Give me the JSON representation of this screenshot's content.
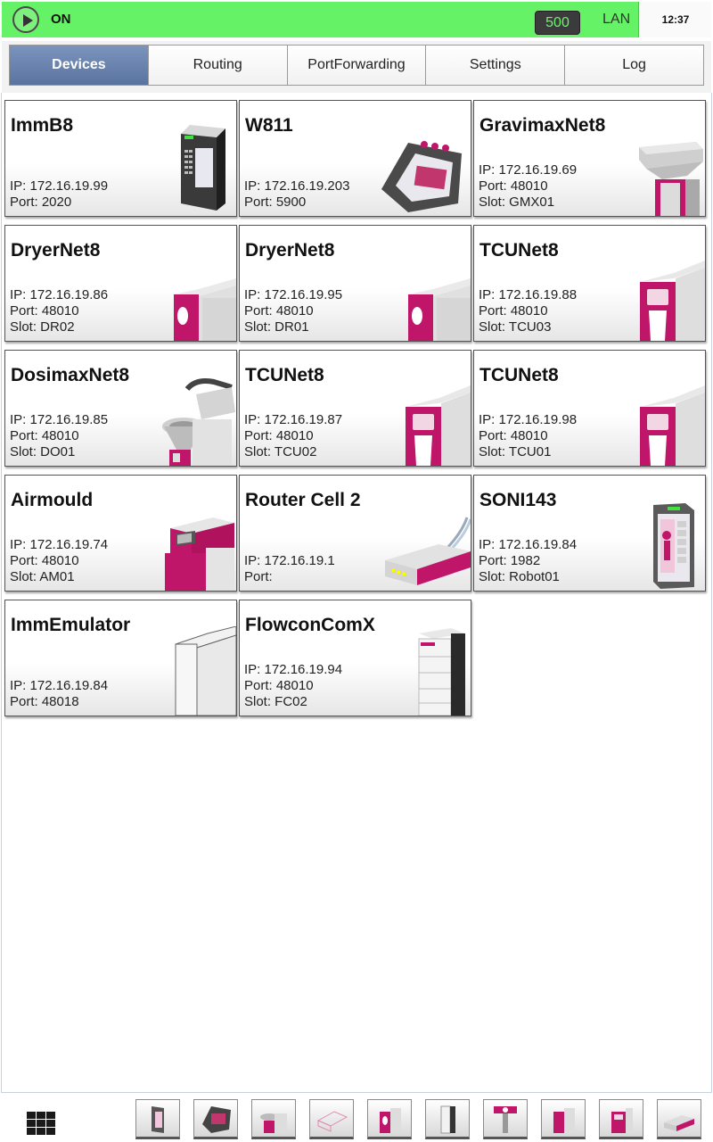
{
  "status": {
    "run_state": "ON",
    "count": "500",
    "connection": "LAN",
    "time": "12:37",
    "colors": {
      "ok_green": "#66f266",
      "badge_bg": "#3b3b3b",
      "tab_active": "#5a74a0",
      "brand_magenta": "#c0166a"
    }
  },
  "tabs": [
    {
      "label": "Devices",
      "active": true
    },
    {
      "label": "Routing",
      "active": false
    },
    {
      "label": "PortForwarding",
      "active": false
    },
    {
      "label": "Settings",
      "active": false
    },
    {
      "label": "Log",
      "active": false
    }
  ],
  "devices": [
    {
      "name": "ImmB8",
      "lines": [
        "IP: 172.16.19.99",
        "Port: 2020"
      ],
      "icon": "imm-controller-icon"
    },
    {
      "name": "W811",
      "lines": [
        "IP: 172.16.19.203",
        "Port: 5900"
      ],
      "icon": "handheld-terminal-icon"
    },
    {
      "name": "GravimaxNet8",
      "lines": [
        "IP: 172.16.19.69",
        "Port: 48010",
        "Slot: GMX01"
      ],
      "icon": "gravimetric-blender-icon"
    },
    {
      "name": "DryerNet8",
      "lines": [
        "IP: 172.16.19.86",
        "Port: 48010",
        "Slot: DR02"
      ],
      "icon": "dryer-icon"
    },
    {
      "name": "DryerNet8",
      "lines": [
        "IP: 172.16.19.95",
        "Port: 48010",
        "Slot: DR01"
      ],
      "icon": "dryer-icon"
    },
    {
      "name": "TCUNet8",
      "lines": [
        "IP: 172.16.19.88",
        "Port: 48010",
        "Slot: TCU03"
      ],
      "icon": "tcu-icon"
    },
    {
      "name": "DosimaxNet8",
      "lines": [
        "IP: 172.16.19.85",
        "Port: 48010",
        "Slot: DO01"
      ],
      "icon": "dosing-unit-icon"
    },
    {
      "name": "TCUNet8",
      "lines": [
        "IP: 172.16.19.87",
        "Port: 48010",
        "Slot: TCU02"
      ],
      "icon": "tcu-icon"
    },
    {
      "name": "TCUNet8",
      "lines": [
        "IP: 172.16.19.98",
        "Port: 48010",
        "Slot: TCU01"
      ],
      "icon": "tcu-icon"
    },
    {
      "name": "Airmould",
      "lines": [
        "IP: 172.16.19.74",
        "Port: 48010",
        "Slot: AM01"
      ],
      "icon": "airmould-icon"
    },
    {
      "name": "Router Cell 2",
      "lines": [
        "IP: 172.16.19.1",
        "Port:"
      ],
      "icon": "router-icon"
    },
    {
      "name": "SONI143",
      "lines": [
        "IP: 172.16.19.84",
        "Port: 1982",
        "Slot: Robot01"
      ],
      "icon": "robot-panel-icon"
    },
    {
      "name": "ImmEmulator",
      "lines": [
        "IP: 172.16.19.84",
        "Port: 48018"
      ],
      "icon": "emulator-box-icon"
    },
    {
      "name": "FlowconComX",
      "lines": [
        "IP: 172.16.19.94",
        "Port: 48010",
        "Slot: FC02"
      ],
      "icon": "flowcon-icon"
    }
  ],
  "dock": {
    "menu_icon": "grid-menu-icon",
    "shortcuts": [
      "imm-controller-icon",
      "handheld-terminal-icon",
      "dosing-unit-icon",
      "emulator-box-icon",
      "dryer-icon",
      "flowcon-icon",
      "robot-arm-icon",
      "dryer-icon",
      "tcu-icon",
      "router-icon"
    ]
  }
}
